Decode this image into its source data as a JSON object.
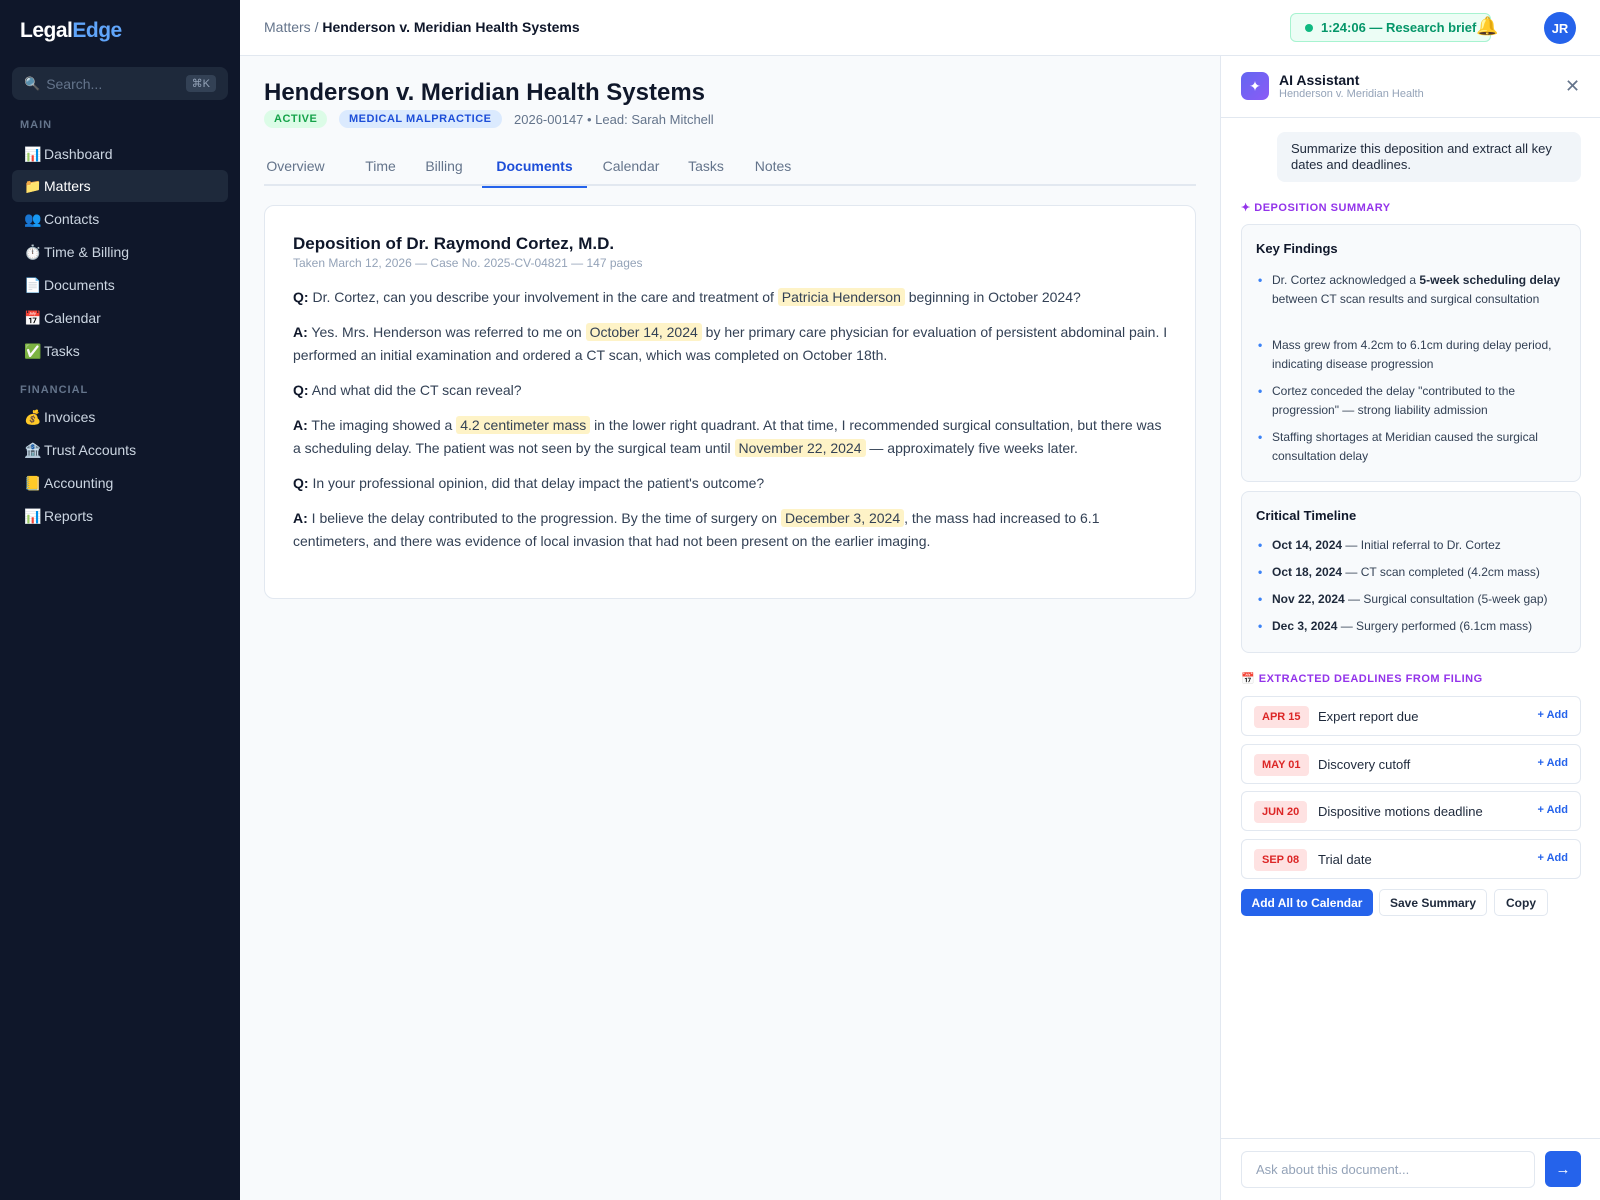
{
  "app": {
    "logo_main": "Legal",
    "logo_accent": "Edge"
  },
  "sidebar": {
    "search_placeholder": "Search...",
    "search_shortcut": "⌘K",
    "sections": {
      "main": "MAIN",
      "financial": "FINANCIAL"
    },
    "main_items": [
      {
        "icon": "📊",
        "label": "Dashboard"
      },
      {
        "icon": "📁",
        "label": "Matters"
      },
      {
        "icon": "👥",
        "label": "Contacts"
      },
      {
        "icon": "⏱️",
        "label": "Time & Billing"
      },
      {
        "icon": "📄",
        "label": "Documents"
      },
      {
        "icon": "📅",
        "label": "Calendar"
      },
      {
        "icon": "✅",
        "label": "Tasks"
      }
    ],
    "financial_items": [
      {
        "icon": "💰",
        "label": "Invoices"
      },
      {
        "icon": "🏦",
        "label": "Trust Accounts"
      },
      {
        "icon": "📒",
        "label": "Accounting"
      },
      {
        "icon": "📊",
        "label": "Reports"
      }
    ]
  },
  "topbar": {
    "breadcrumb_root": "Matters",
    "breadcrumb_sep": " / ",
    "breadcrumb_current": "Henderson v. Meridian Health Systems",
    "timer": "1:24:06 — Research brief",
    "avatar_initials": "JR"
  },
  "matter": {
    "title": "Henderson v. Meridian Health Systems",
    "status_badge": "ACTIVE",
    "type_badge": "MEDICAL MALPRACTICE",
    "meta": "2026-00147 • Lead: Sarah Mitchell",
    "tabs": [
      "Overview",
      "Time",
      "Billing",
      "Documents",
      "Calendar",
      "Tasks",
      "Notes"
    ],
    "active_tab": "Documents"
  },
  "document": {
    "title": "Deposition of Dr. Raymond Cortez, M.D.",
    "subtitle": "Taken March 12, 2026 — Case No. 2025-CV-04821 — 147 pages",
    "q_label": "Q:",
    "a_label": "A:",
    "p1": {
      "pre": "Dr. Cortez, can you describe your involvement in the care and treatment of",
      "hl": "Patricia Henderson",
      "post": "beginning in October 2024?"
    },
    "p2": {
      "pre": "Yes. Mrs. Henderson was referred to me on",
      "hl": "October 14, 2024",
      "post": "by her primary care physician for evaluation of persistent abdominal pain. I performed an initial examination and ordered a CT scan, which was completed on October 18th."
    },
    "p3": {
      "text": "And what did the CT scan reveal?"
    },
    "p4": {
      "pre": "The imaging showed a",
      "hl": "4.2 centimeter mass",
      "mid": "in the lower right quadrant. At that time, I recommended surgical consultation, but there was a scheduling delay. The patient was not seen by the surgical team until",
      "hl2": "November 22, 2024",
      "post": "— approximately five weeks later."
    },
    "p5": {
      "text": "In your professional opinion, did that delay impact the patient's outcome?"
    },
    "p6": {
      "pre": "I believe the delay contributed to the progression. By the time of surgery on",
      "hl": "December 3, 2024",
      "post": ", the mass had increased to 6.1 centimeters, and there was evidence of local invasion that had not been present on the earlier imaging."
    }
  },
  "ai": {
    "logo_glyph": "✦",
    "title": "AI Assistant",
    "subtitle": "Henderson v. Meridian Health",
    "close_glyph": "✕",
    "user_message": "Summarize this deposition and extract all key dates and deadlines.",
    "summary_label": "✦ DEPOSITION SUMMARY",
    "findings_title": "Key Findings",
    "findings": [
      {
        "pre": "Dr. Cortez acknowledged a ",
        "bold": "5-week scheduling delay",
        "post": " between CT scan results and surgical consultation"
      },
      {
        "pre": "Mass grew from 4.2cm to 6.1cm during delay period, indicating disease progression",
        "bold": "",
        "post": ""
      },
      {
        "pre": "Cortez conceded the delay \"contributed to the progression\" — strong liability admission",
        "bold": "",
        "post": ""
      },
      {
        "pre": "Staffing shortages at Meridian caused the surgical consultation delay",
        "bold": "",
        "post": ""
      }
    ],
    "timeline_title": "Critical Timeline",
    "timeline": [
      {
        "date": "Oct 14, 2024",
        "text": " — Initial referral to Dr. Cortez"
      },
      {
        "date": "Oct 18, 2024",
        "text": " — CT scan completed (4.2cm mass)"
      },
      {
        "date": "Nov 22, 2024",
        "text": " — Surgical consultation (5-week gap)"
      },
      {
        "date": "Dec 3, 2024",
        "text": " — Surgery performed (6.1cm mass)"
      }
    ],
    "deadlines_label": "📅 EXTRACTED DEADLINES FROM FILING",
    "deadlines": [
      {
        "date": "APR 15",
        "label": "Expert report due",
        "action": "+ Add"
      },
      {
        "date": "MAY 01",
        "label": "Discovery cutoff",
        "action": "+ Add"
      },
      {
        "date": "JUN 20",
        "label": "Dispositive motions deadline",
        "action": "+ Add"
      },
      {
        "date": "SEP 08",
        "label": "Trial date",
        "action": "+ Add"
      }
    ],
    "buttons": {
      "add_all": "Add All to Calendar",
      "save": "Save Summary",
      "copy": "Copy"
    },
    "input_placeholder": "Ask about this document...",
    "send_glyph": "→"
  },
  "colors": {
    "sidebar_bg": "#0f172a",
    "accent": "#2563eb",
    "highlight": "#fef3c7",
    "ai_accent": "#9333ea",
    "deadline_red": "#dc2626",
    "timer_green": "#059669"
  }
}
